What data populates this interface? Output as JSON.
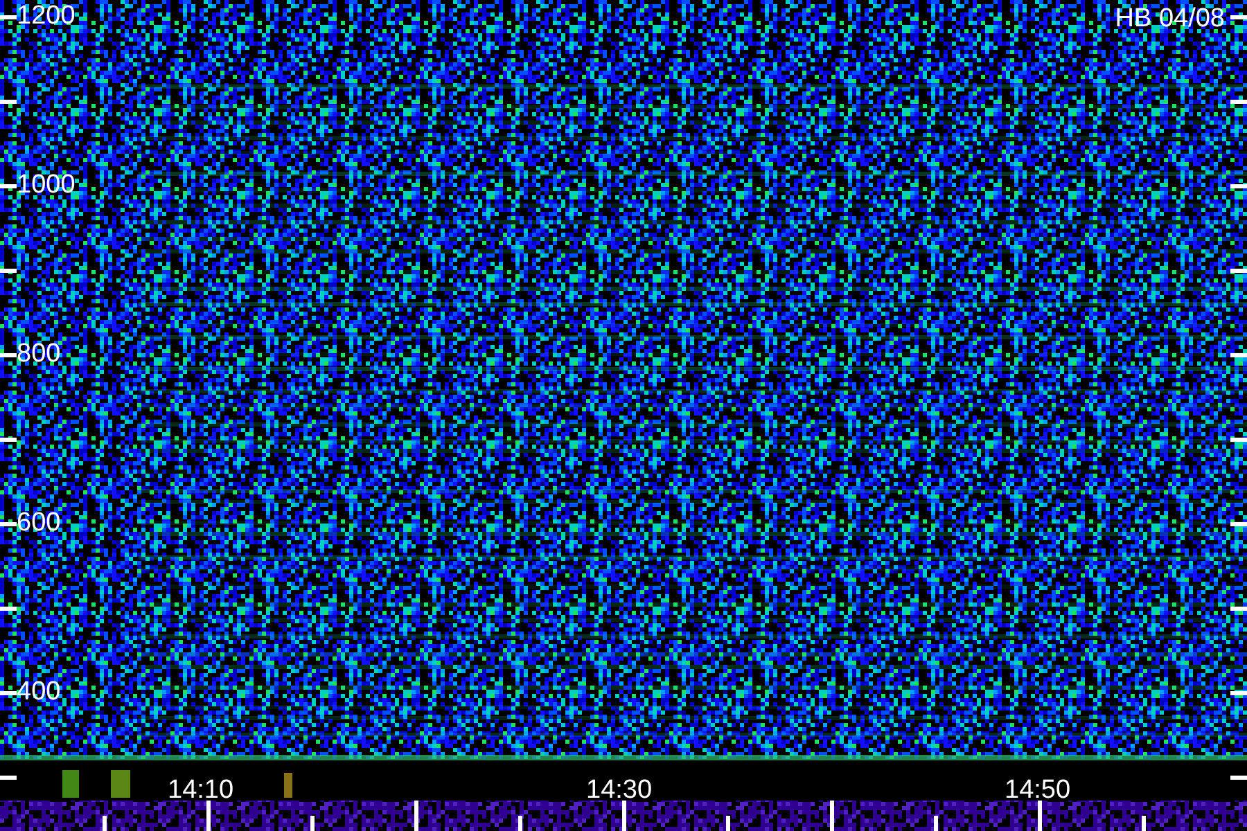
{
  "spectrogram": {
    "title": "HB 04/08",
    "y_labels": [
      "1200",
      "1000",
      "800",
      "600",
      "400"
    ],
    "time_labels": [
      "14:10",
      "14:30",
      "14:50"
    ]
  }
}
